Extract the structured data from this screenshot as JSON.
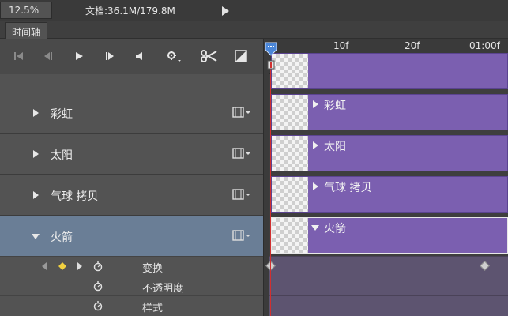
{
  "statusbar": {
    "zoom": "12.5%",
    "doc_info": "文档:36.1M/179.8M"
  },
  "panel": {
    "tab_label": "时间轴"
  },
  "toolbar": {
    "buttons": [
      "go-to-first-frame-icon",
      "previous-frame-icon",
      "play-icon",
      "next-frame-icon",
      "audio-icon",
      "settings-icon",
      "split-scissors-icon",
      "transition-icon"
    ]
  },
  "ruler": {
    "labels": [
      "10f",
      "20f",
      "01:00f"
    ]
  },
  "layers": [
    {
      "name": "彩虹",
      "expanded": false,
      "selected": false
    },
    {
      "name": "太阳",
      "expanded": false,
      "selected": false
    },
    {
      "name": "气球 拷贝",
      "expanded": false,
      "selected": false
    },
    {
      "name": "火箭",
      "expanded": true,
      "selected": true
    }
  ],
  "properties": [
    {
      "name": "变换",
      "has_keyframes": true
    },
    {
      "name": "不透明度",
      "has_keyframes": false
    },
    {
      "name": "样式",
      "has_keyframes": false
    }
  ],
  "colors": {
    "clip": "#7b5fb0",
    "selected_layer": "#6a7e96",
    "playhead": "#d13030",
    "keyframe_nav_diamond": "#f0d040"
  }
}
